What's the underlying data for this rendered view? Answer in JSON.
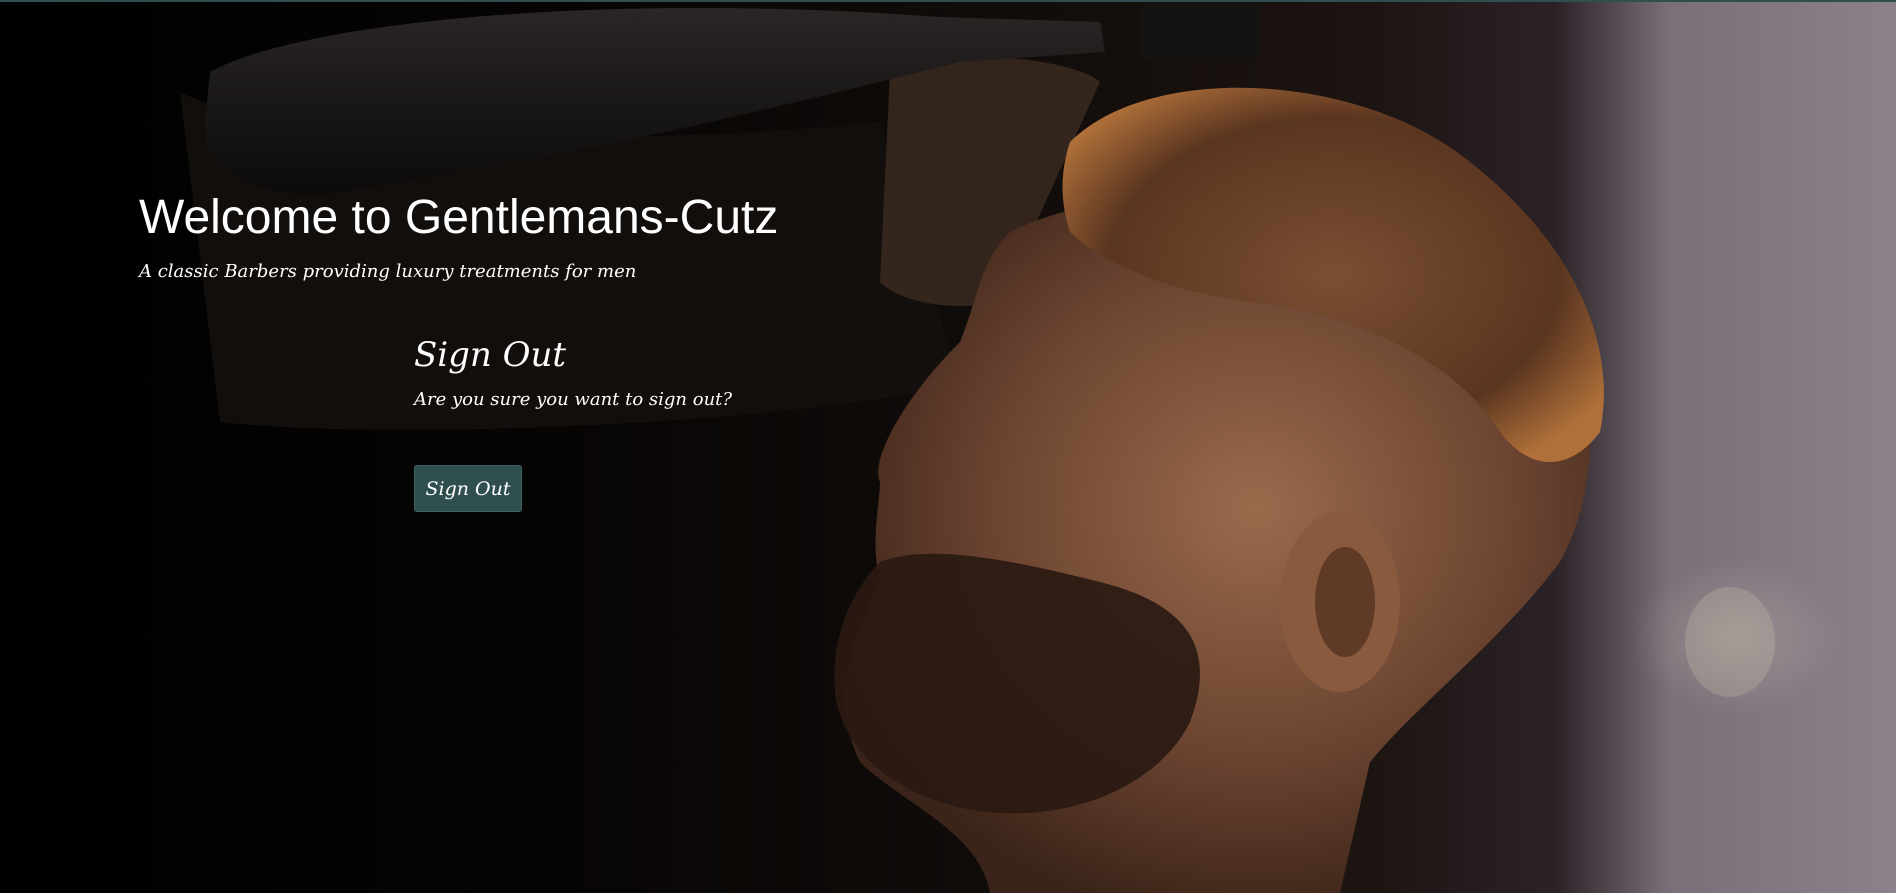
{
  "hero": {
    "title": "Welcome to Gentlemans-Cutz",
    "subtitle": "A classic Barbers providing luxury treatments for men"
  },
  "signout": {
    "heading": "Sign Out",
    "question": "Are you sure you want to sign out?",
    "button_label": "Sign Out"
  },
  "colors": {
    "accent": "#2f4f4f",
    "text": "#ffffff",
    "overlay": "#000000"
  }
}
